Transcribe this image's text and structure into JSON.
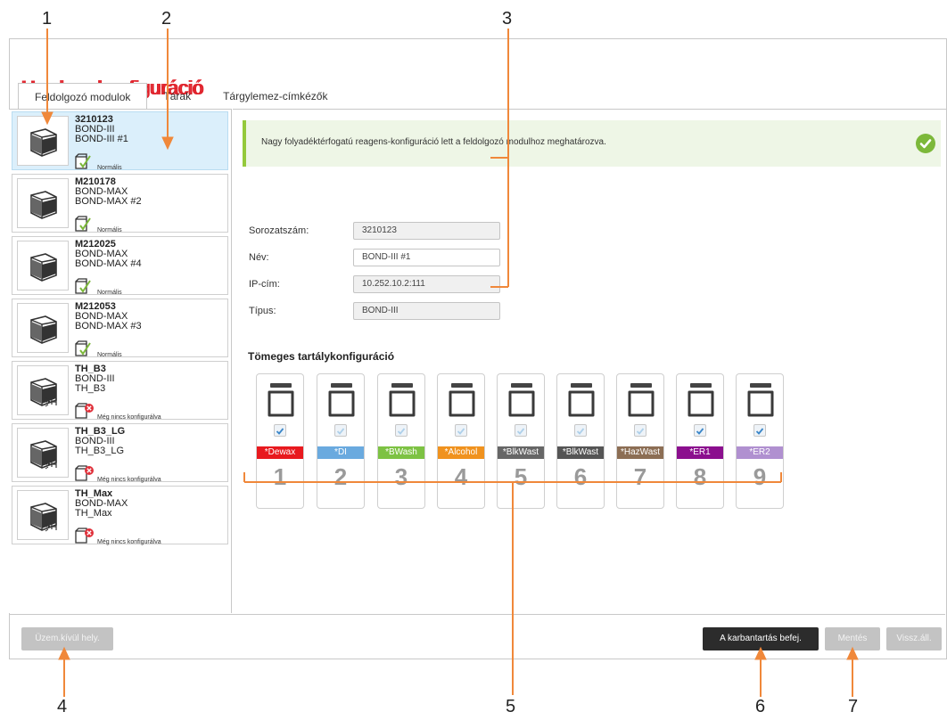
{
  "callouts": [
    "1",
    "2",
    "3",
    "4",
    "5",
    "6",
    "7"
  ],
  "window_title": "Hardver-konfiguráció",
  "tabs": [
    {
      "label": "Feldolgozó modulok",
      "active": true
    },
    {
      "label": "Tárak",
      "active": false
    },
    {
      "label": "Tárgylemez-címkézők",
      "active": false
    }
  ],
  "modules": [
    {
      "serial": "3210123",
      "type": "BOND-III",
      "name": "BOND-III  #1",
      "status": "Normális",
      "status_kind": "ok",
      "selected": true
    },
    {
      "serial": "M210178",
      "type": "BOND-MAX",
      "name": "BOND-MAX #2",
      "status": "Normális",
      "status_kind": "ok",
      "selected": false
    },
    {
      "serial": "M212025",
      "type": "BOND-MAX",
      "name": "BOND-MAX #4",
      "status": "Normális",
      "status_kind": "ok",
      "selected": false
    },
    {
      "serial": "M212053",
      "type": "BOND-MAX",
      "name": "BOND-MAX #3",
      "status": "Normális",
      "status_kind": "ok",
      "selected": false
    },
    {
      "serial": "TH_B3",
      "type": "BOND-III",
      "name": "TH_B3",
      "status": "Még nincs konfigurálva",
      "status_kind": "error",
      "selected": false
    },
    {
      "serial": "TH_B3_LG",
      "type": "BOND-III",
      "name": "TH_B3_LG",
      "status": "Még nincs konfigurálva",
      "status_kind": "error",
      "selected": false
    },
    {
      "serial": "TH_Max",
      "type": "BOND-MAX",
      "name": "TH_Max",
      "status": "Még nincs konfigurálva",
      "status_kind": "error",
      "selected": false
    }
  ],
  "banner": {
    "text": "Nagy folyadéktérfogatú reagens-konfiguráció lett a feldolgozó modulhoz meghatározva.",
    "color": "#7cb83a"
  },
  "fields": {
    "serial": {
      "label": "Sorozatszám:",
      "value": "3210123"
    },
    "name": {
      "label": "Név:",
      "value": "BOND-III  #1"
    },
    "ip": {
      "label": "IP-cím:",
      "value": "10.252.10.2:111"
    },
    "type": {
      "label": "Típus:",
      "value": "BOND-III"
    }
  },
  "bulk_title": "Tömeges tartálykonfiguráció",
  "bottles": [
    {
      "label": "*Dewax",
      "number": "1",
      "color": "#e8191e",
      "checked": true,
      "enabled": true
    },
    {
      "label": "*DI",
      "number": "2",
      "color": "#6aaadf",
      "checked": true,
      "enabled": false
    },
    {
      "label": "*BWash",
      "number": "3",
      "color": "#7dc243",
      "checked": true,
      "enabled": false
    },
    {
      "label": "*Alcohol",
      "number": "4",
      "color": "#f0921e",
      "checked": true,
      "enabled": false
    },
    {
      "label": "*BlkWast",
      "number": "5",
      "color": "#666666",
      "checked": true,
      "enabled": false
    },
    {
      "label": "*BlkWast",
      "number": "6",
      "color": "#555555",
      "checked": true,
      "enabled": false
    },
    {
      "label": "*HazWast",
      "number": "7",
      "color": "#8c6e54",
      "checked": true,
      "enabled": false
    },
    {
      "label": "*ER1",
      "number": "8",
      "color": "#8b0f8e",
      "checked": true,
      "enabled": true
    },
    {
      "label": "*ER2",
      "number": "9",
      "color": "#b090d0",
      "checked": true,
      "enabled": true
    }
  ],
  "buttons": {
    "decommission": "Üzem.kívül hely.",
    "end_maintenance": "A karbantartás befej.",
    "save": "Mentés",
    "revert": "Vissz.áll."
  }
}
